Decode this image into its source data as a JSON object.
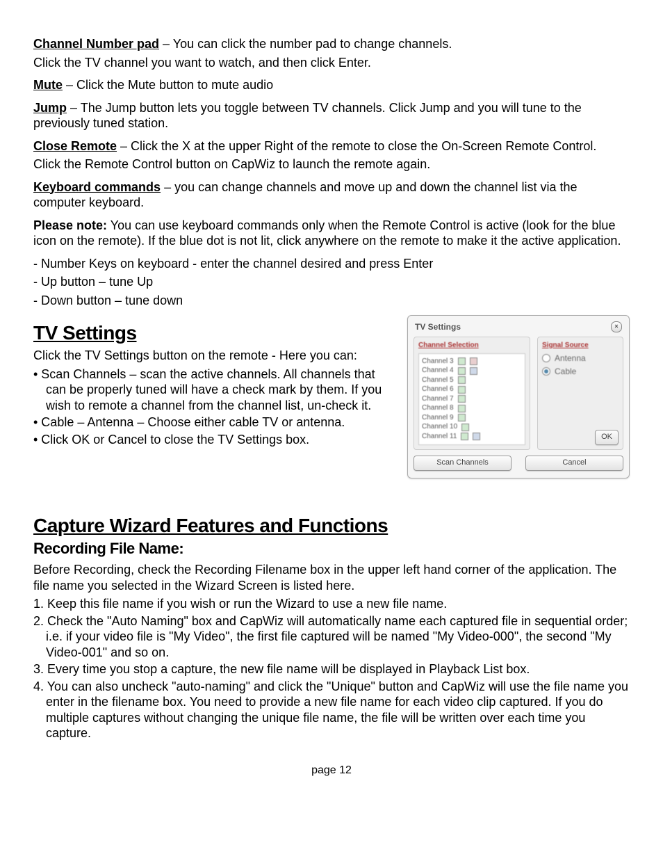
{
  "defs": {
    "channel_number_pad": {
      "term": "Channel Number pad",
      "text1": " – You can click the number pad to change channels.",
      "text2": "Click the TV channel you want to watch, and then click Enter."
    },
    "mute": {
      "term": "Mute",
      "text": " –  Click the Mute button to mute audio"
    },
    "jump": {
      "term": "Jump",
      "text": " – The Jump button lets you toggle between TV channels. Click Jump and you will tune to the previously tuned station."
    },
    "close_remote": {
      "term": "Close Remote",
      "text1": " – Click the X at the upper Right of the remote to close the On-Screen Remote Control.",
      "text2": "Click the Remote Control button on CapWiz to launch the remote again."
    },
    "keyboard": {
      "term": "Keyboard commands",
      "text": " – you can change channels and move up and down the channel list via the computer keyboard."
    }
  },
  "note": {
    "label": "Please note:",
    "text": " You can use keyboard commands only when the Remote Control is active (look for the blue icon on the remote). If the blue dot is not lit, click anywhere on the remote to make it the active application."
  },
  "keys": {
    "a": "- Number Keys on keyboard -  enter the channel desired and press Enter",
    "b": "- Up button – tune Up",
    "c": "- Down button – tune down"
  },
  "tv_settings": {
    "heading": "TV Settings",
    "intro": "Click the TV Settings button on the remote -  Here you can:",
    "b1": "• Scan Channels – scan the active channels. All channels that can be properly tuned will have a check mark by them. If you wish to remote a channel from the channel list, un-check it.",
    "b2": "• Cable – Antenna – Choose either cable TV or antenna.",
    "b3": "• Click OK or Cancel to close the TV Settings box."
  },
  "capture": {
    "heading": "Capture Wizard Features and Functions",
    "sub": "Recording File Name:",
    "intro": "Before Recording, check the Recording Filename box in the upper left hand corner of the application. The file name you selected in the Wizard Screen is listed here.",
    "n1": "1. Keep this file name if you wish or run the Wizard to use a new file name.",
    "n2": "2. Check the \"Auto Naming\" box and CapWiz will automatically name each captured file in sequential order; i.e. if your video file is \"My Video\", the first file captured will be named \"My Video-000\", the second \"My Video-001\" and so on.",
    "n3": "3. Every time you stop a capture, the new file name will be displayed in Playback List box.",
    "n4": "4. You can also uncheck \"auto-naming\" and click the \"Unique\" button and CapWiz will use the file name you enter in the filename box.   You need to provide a new file name for each video clip captured. If you do multiple captures without changing the unique file name, the file will be written over each time you capture."
  },
  "dialog": {
    "title": "TV Settings",
    "left_header": "Channel Selection",
    "right_header": "Signal Source",
    "channels": [
      "Channel 3",
      "Channel 4",
      "Channel 5",
      "Channel 6",
      "Channel 7",
      "Channel 8",
      "Channel 9",
      "Channel 10",
      "Channel 11"
    ],
    "radio1": "Antenna",
    "radio2": "Cable",
    "scan": "Scan Channels",
    "ok": "OK",
    "cancel": "Cancel"
  },
  "page": "page 12"
}
